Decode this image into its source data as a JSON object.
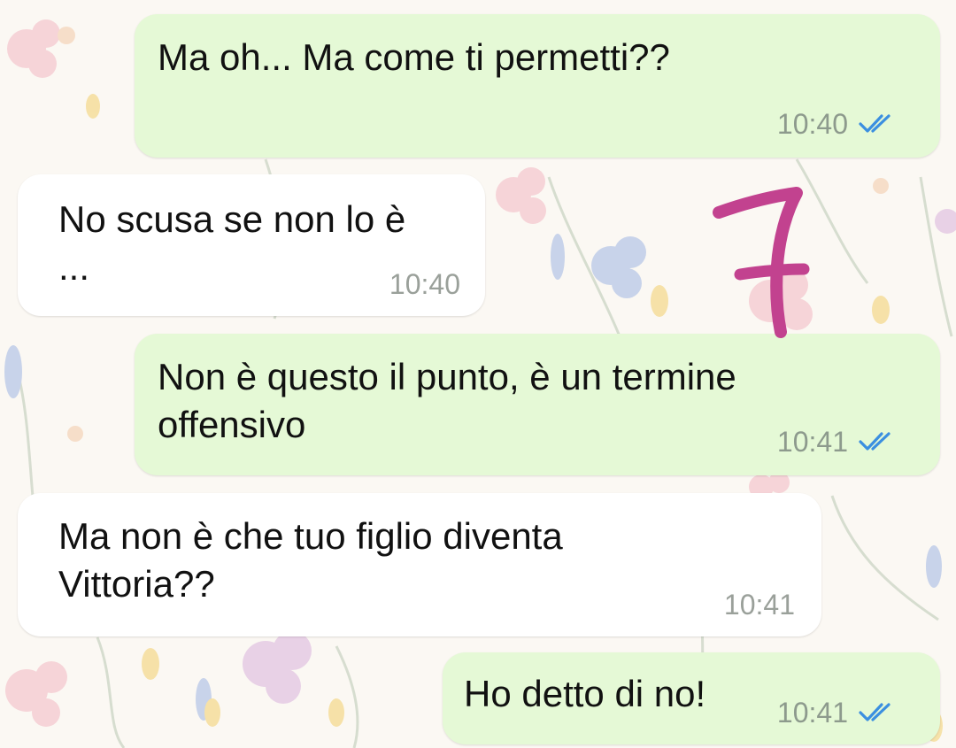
{
  "messages": [
    {
      "id": "m1",
      "direction": "outgoing",
      "text": "Ma oh... Ma come ti permetti??",
      "time": "10:40",
      "status": "read"
    },
    {
      "id": "m2",
      "direction": "incoming",
      "text": "No scusa se non lo è\n...",
      "time": "10:40"
    },
    {
      "id": "m3",
      "direction": "outgoing",
      "text": "Non è questo il punto, è un termine\noffensivo",
      "time": "10:41",
      "status": "read"
    },
    {
      "id": "m4",
      "direction": "incoming",
      "text": "Ma non è che tuo figlio diventa\nVittoria??",
      "time": "10:41"
    },
    {
      "id": "m5",
      "direction": "outgoing",
      "text": "Ho detto di no!",
      "time": "10:41",
      "status": "read"
    }
  ],
  "annotation": {
    "text": "7",
    "color": "#c2428f"
  },
  "icons": {
    "read_receipt": "double-check-icon"
  },
  "colors": {
    "outgoing_bubble": "#e5f9d6",
    "incoming_bubble": "#ffffff",
    "read_tick": "#3b8fe0",
    "timestamp": "#8d9a8d",
    "wallpaper": "#fbf8f3"
  }
}
